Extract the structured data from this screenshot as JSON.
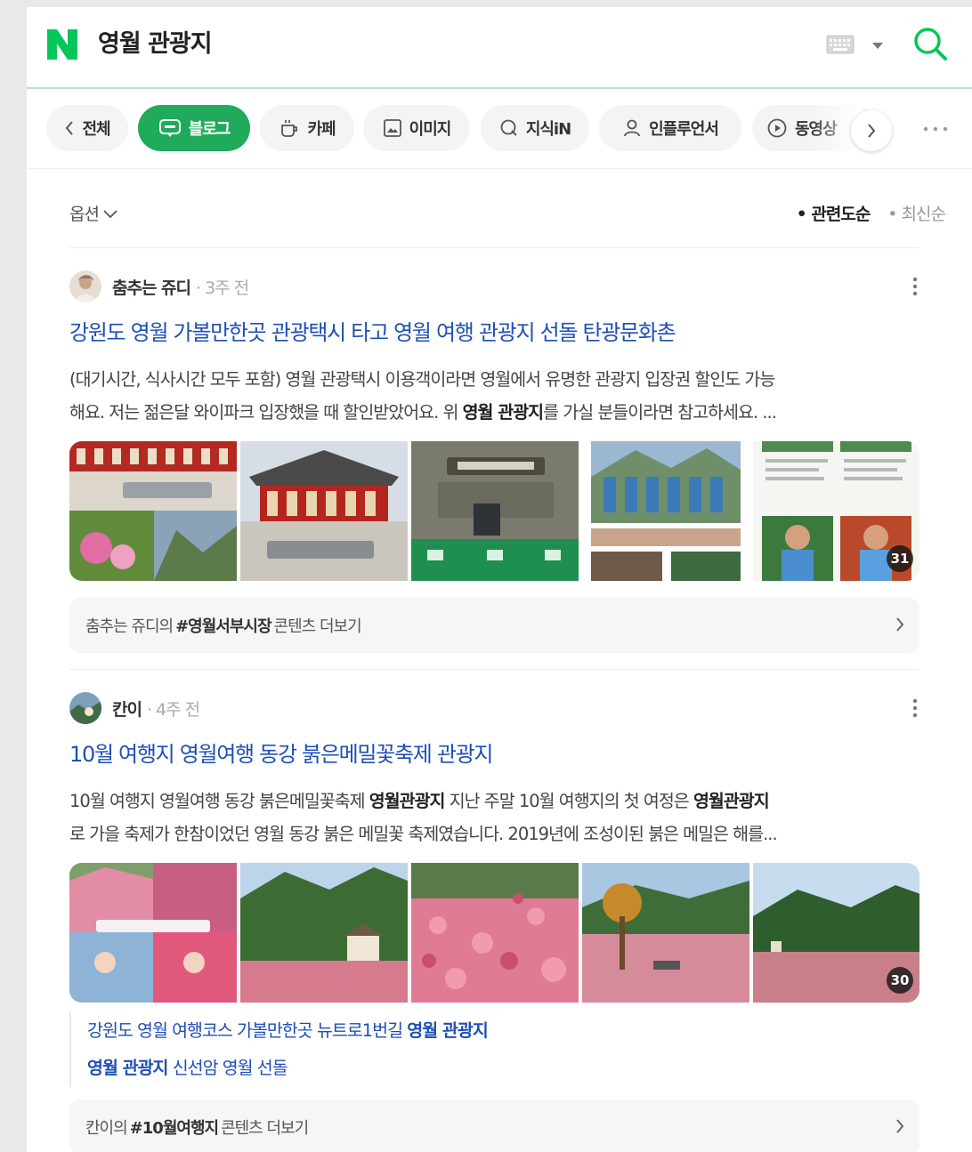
{
  "search": {
    "query": "영월 관광지",
    "logo": "N",
    "brand_color": "#03c75a"
  },
  "tabs": [
    {
      "label": "전체",
      "icon": "chevron-left-icon"
    },
    {
      "label": "블로그",
      "icon": "blog-icon",
      "active": true
    },
    {
      "label": "카페",
      "icon": "cafe-cup-icon"
    },
    {
      "label": "이미지",
      "icon": "image-icon"
    },
    {
      "label": "지식iN",
      "icon": "q-icon"
    },
    {
      "label": "인플루언서",
      "icon": "person-icon"
    },
    {
      "label": "동영상",
      "icon": "play-icon"
    }
  ],
  "options": {
    "label": "옵션",
    "sort_relevance": "관련도순",
    "sort_latest": "최신순"
  },
  "posts": [
    {
      "author": "춤추는 쥬디",
      "time": "· 3주 전",
      "title": "강원도 영월 가볼만한곳 관광택시 타고 영월 여행 관광지 선돌 탄광문화촌",
      "desc_line1": "(대기시간, 식사시간 모두 포함) 영월 관광택시 이용객이라면 영월에서 유명한 관광지 입장권 할인도 가능",
      "desc_line2_pre": "해요. 저는 젊은달 와이파크 입장했을 때 할인받았어요. 위 ",
      "desc_line2_bold": "영월 관광지",
      "desc_line2_post": "를 가실 분들이라면 참고하세요. ...",
      "photo_count": "31",
      "more_prefix": "춤추는 쥬디의",
      "more_tag": "#영월서부시장",
      "more_suffix": "콘텐츠 더보기"
    },
    {
      "author": "칸이",
      "time": "· 4주 전",
      "title": "10월 여행지 영월여행 동강 붉은메밀꽃축제 관광지",
      "desc_line1_pre": "10월 여행지 영월여행 동강 붉은메밀꽃축제 ",
      "desc_line1_bold1": "영월관광지",
      "desc_line1_mid": " 지난 주말 10월 여행지의 첫 여정은 ",
      "desc_line1_bold2": "영월관광지",
      "desc_line2": "로 가을 축제가 한참이었던 영월 동강 붉은 메밀꽃 축제였습니다. 2019년에 조성이된 붉은 메밀은 해를...",
      "photo_count": "30",
      "related1_pre": "강원도 영월 여행코스 가볼만한곳 뉴트로1번길 ",
      "related1_bold": "영월 관광지",
      "related2_bold": "영월 관광지",
      "related2_post": " 신선암 영월 선돌",
      "more_prefix": "칸이의",
      "more_tag": "#10월여행지",
      "more_suffix": "콘텐츠 더보기"
    }
  ]
}
